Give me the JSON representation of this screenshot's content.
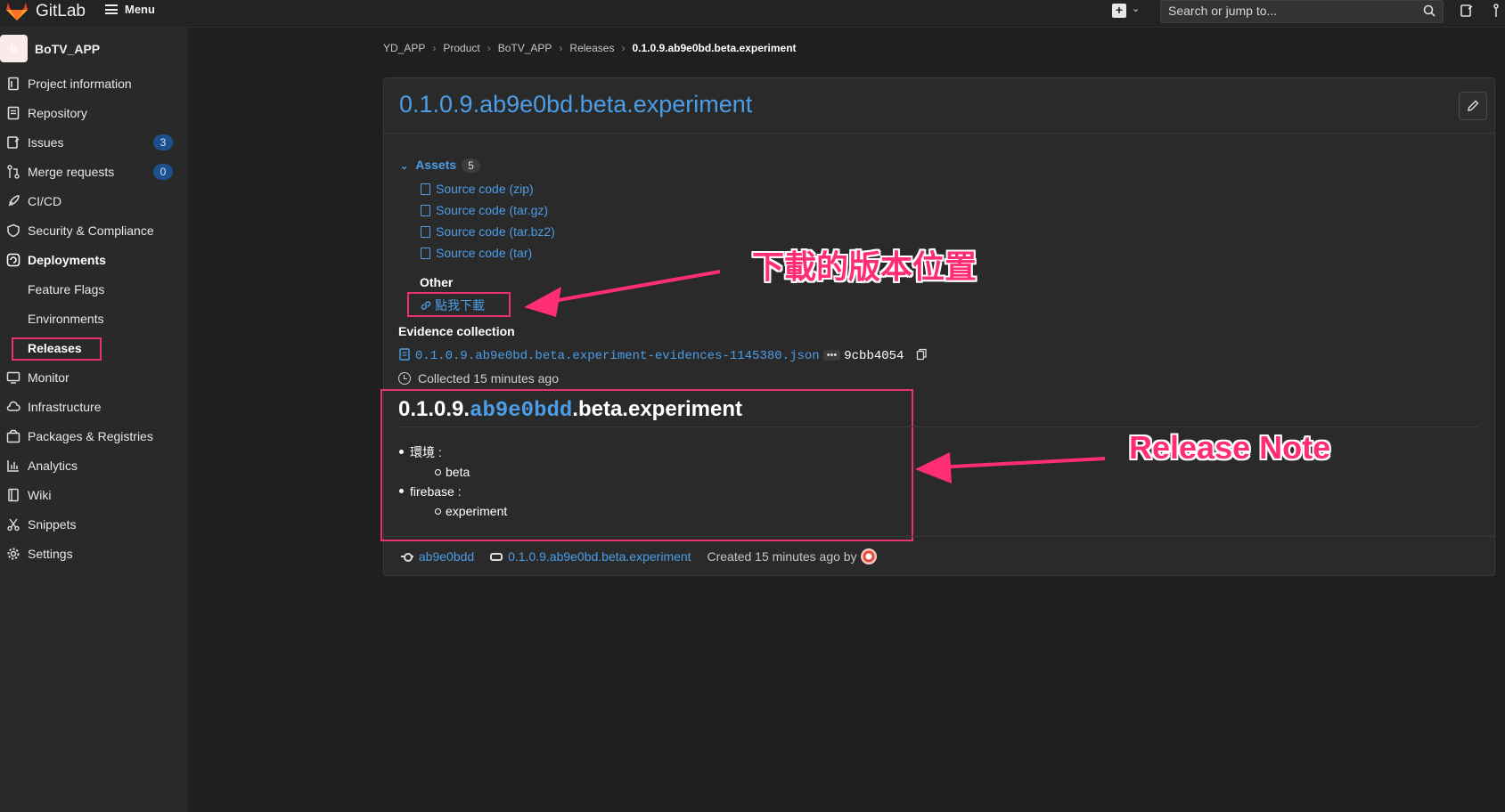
{
  "topbar": {
    "brand": "GitLab",
    "menu_label": "Menu",
    "search_placeholder": "Search or jump to..."
  },
  "sidebar": {
    "avatar_letter": "B",
    "project_name": "BoTV_APP",
    "items": [
      {
        "label": "Project information",
        "icon": "info-doc-icon"
      },
      {
        "label": "Repository",
        "icon": "repo-doc-icon"
      },
      {
        "label": "Issues",
        "icon": "issues-icon",
        "badge": "3"
      },
      {
        "label": "Merge requests",
        "icon": "merge-request-icon",
        "badge": "0"
      },
      {
        "label": "CI/CD",
        "icon": "rocket-icon"
      },
      {
        "label": "Security & Compliance",
        "icon": "shield-icon"
      },
      {
        "label": "Deployments",
        "icon": "deployments-icon"
      },
      {
        "label": "Feature Flags"
      },
      {
        "label": "Environments"
      },
      {
        "label": "Releases"
      },
      {
        "label": "Monitor",
        "icon": "monitor-icon"
      },
      {
        "label": "Infrastructure",
        "icon": "cloud-icon"
      },
      {
        "label": "Packages & Registries",
        "icon": "package-icon"
      },
      {
        "label": "Analytics",
        "icon": "chart-icon"
      },
      {
        "label": "Wiki",
        "icon": "book-icon"
      },
      {
        "label": "Snippets",
        "icon": "scissors-icon"
      },
      {
        "label": "Settings",
        "icon": "gear-icon"
      }
    ]
  },
  "breadcrumb": [
    "YD_APP",
    "Product",
    "BoTV_APP",
    "Releases",
    "0.1.0.9.ab9e0bd.beta.experiment"
  ],
  "release": {
    "title": "0.1.0.9.ab9e0bd.beta.experiment",
    "assets_label": "Assets",
    "assets_count": "5",
    "sources": [
      "Source code (zip)",
      "Source code (tar.gz)",
      "Source code (tar.bz2)",
      "Source code (tar)"
    ],
    "other_label": "Other",
    "other_link": "點我下載",
    "evidence_label": "Evidence collection",
    "evidence_file": "0.1.0.9.ab9e0bd.beta.experiment-evidences-1145380.json",
    "evidence_dots": "•••",
    "evidence_sha": "9cbb4054",
    "collected": "Collected 15 minutes ago"
  },
  "note": {
    "title_prefix": "0.1.0.9.",
    "title_hash": "ab9e0bdd",
    "title_suffix": ".beta.experiment",
    "env_label": "環境 :",
    "env_value": "beta",
    "firebase_label": "firebase :",
    "firebase_value": "experiment"
  },
  "footer": {
    "commit": "ab9e0bdd",
    "tag": "0.1.0.9.ab9e0bd.beta.experiment",
    "created": "Created 15 minutes ago by"
  },
  "annotations": {
    "download_note": "下載的版本位置",
    "release_note": "Release Note",
    "color": "#ff2e72"
  }
}
